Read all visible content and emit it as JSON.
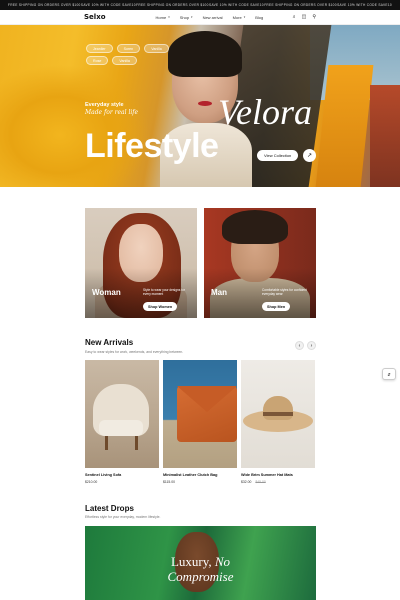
{
  "promo_bar": {
    "messages": [
      "FREE SHIPPING ON ORDERS OVER $100",
      "SAVE 10% WITH CODE SAVE10",
      "FREE SHIPPING ON ORDERS OVER $100",
      "SAVE 10% WITH CODE SAVE10",
      "FREE SHIPPING ON ORDERS OVER $100",
      "SAVE 10% WITH CODE SAVE10"
    ]
  },
  "header": {
    "logo": "Selxo",
    "nav": [
      {
        "label": "Home",
        "has_menu": true
      },
      {
        "label": "Shop",
        "has_menu": true
      },
      {
        "label": "New arrival",
        "has_menu": false
      },
      {
        "label": "More",
        "has_menu": true
      },
      {
        "label": "Blog",
        "has_menu": false
      }
    ],
    "icons": [
      "search-icon",
      "bag-icon",
      "user-icon"
    ]
  },
  "hero": {
    "chips_row1": [
      "Jeanlier",
      "Soren",
      "Vanilla"
    ],
    "chips_row2": [
      "Rose",
      "Vanilla"
    ],
    "eyebrow": "Everyday style",
    "tagline": "Made for real life",
    "title": "Lifestyle",
    "brand_script": "Velora",
    "cta": "View Collection",
    "cta_arrow": "↗"
  },
  "categories": [
    {
      "label": "Woman",
      "description": "Style to wear your designs for every moment",
      "button": "Shop Women"
    },
    {
      "label": "Man",
      "description": "Comfortable styles for confident everyday wear",
      "button": "Shop Men"
    }
  ],
  "new_arrivals": {
    "title": "New Arrivals",
    "subtitle": "Easy to wear styles for work, weekends, and everything between.",
    "prev_icon": "‹",
    "next_icon": "›",
    "products": [
      {
        "name": "Sentinel Living Sofa",
        "price": "$210.00",
        "old_price": ""
      },
      {
        "name": "Minimalist Leather Clutch Bag",
        "price": "$115.00",
        "old_price": ""
      },
      {
        "name": "Wide Brim Summer Hat Mats",
        "price": "$32.00",
        "old_price": "$45.00"
      }
    ]
  },
  "latest_drops": {
    "title": "Latest Drops",
    "subtitle": "Effortless style for your everyday, modern lifestyle.",
    "banner_line1": "Luxury,",
    "banner_line1_italic": "No",
    "banner_line2": "Compromise"
  },
  "side_widget": {
    "icon": "⇵"
  },
  "colors": {
    "accent": "#111111",
    "hero_yellow": "#f0b320",
    "banner_green": "#2f9447"
  }
}
